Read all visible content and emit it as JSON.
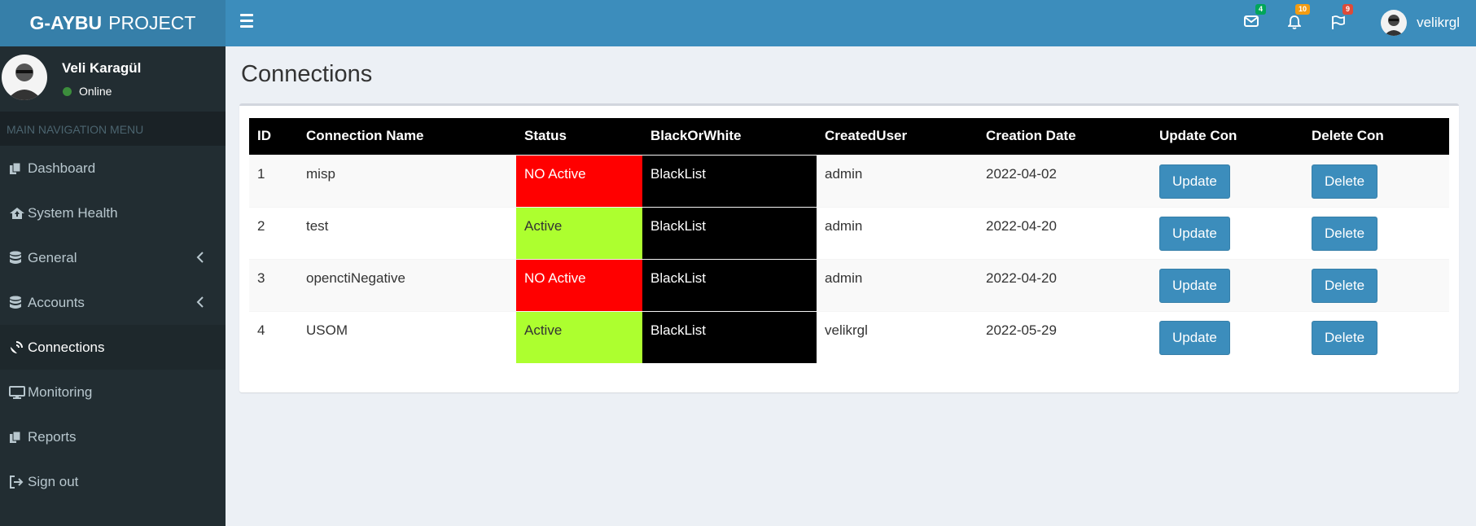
{
  "header": {
    "logo_bold": "G-AYBU",
    "logo_rest": "PROJECT",
    "mail_badge": "4",
    "notif_badge": "10",
    "flag_badge": "9",
    "username": "velikrgl",
    "colors": {
      "mail": "#00a65a",
      "notif": "#f39c12",
      "flag": "#dd4b39"
    }
  },
  "sidebar": {
    "user_name": "Veli Karagül",
    "user_status": "Online",
    "menu_header": "MAIN NAVIGATION MENU",
    "items": [
      {
        "label": "Dashboard",
        "icon": "files-icon"
      },
      {
        "label": "System Health",
        "icon": "home-upload-icon"
      },
      {
        "label": "General",
        "icon": "database-icon"
      },
      {
        "label": "Accounts",
        "icon": "database-icon"
      },
      {
        "label": "Connections",
        "icon": "satellite-dish-icon"
      },
      {
        "label": "Monitoring",
        "icon": "desktop-icon"
      },
      {
        "label": "Reports",
        "icon": "files-icon"
      },
      {
        "label": "Sign out",
        "icon": "sign-out-icon"
      }
    ]
  },
  "main": {
    "title": "Connections",
    "table": {
      "headers": [
        "ID",
        "Connection Name",
        "Status",
        "BlackOrWhite",
        "CreatedUser",
        "Creation Date",
        "Update Con",
        "Delete Con"
      ],
      "rows": [
        {
          "id": "1",
          "name": "misp",
          "status": "NO Active",
          "bw": "BlackList",
          "user": "admin",
          "date": "2022-04-02",
          "update": "Update",
          "delete": "Delete"
        },
        {
          "id": "2",
          "name": "test",
          "status": "Active",
          "bw": "BlackList",
          "user": "admin",
          "date": "2022-04-20",
          "update": "Update",
          "delete": "Delete"
        },
        {
          "id": "3",
          "name": "openctiNegative",
          "status": "NO Active",
          "bw": "BlackList",
          "user": "admin",
          "date": "2022-04-20",
          "update": "Update",
          "delete": "Delete"
        },
        {
          "id": "4",
          "name": "USOM",
          "status": "Active",
          "bw": "BlackList",
          "user": "velikrgl",
          "date": "2022-05-29",
          "update": "Update",
          "delete": "Delete"
        }
      ]
    }
  }
}
